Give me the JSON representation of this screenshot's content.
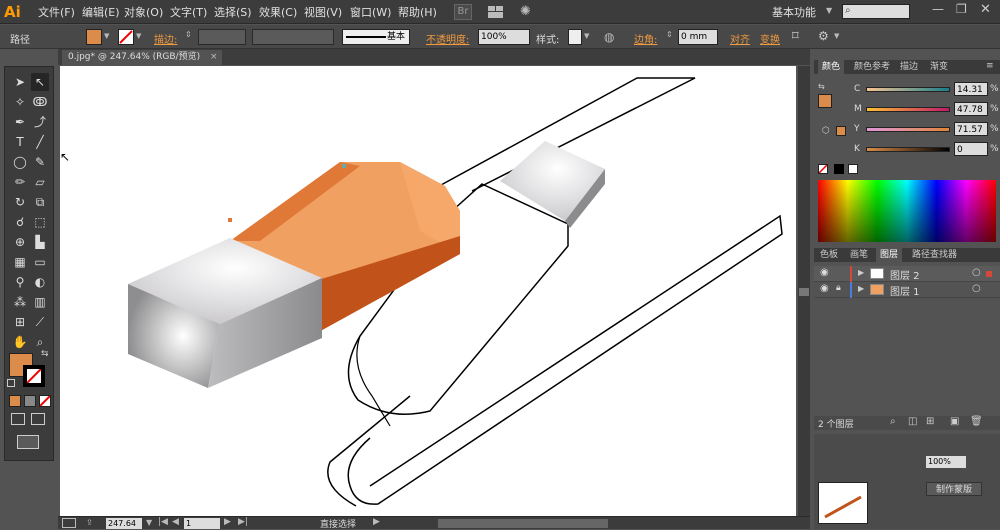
{
  "menubar": {
    "logo": "Ai",
    "items": [
      "文件(F)",
      "编辑(E)",
      "对象(O)",
      "文字(T)",
      "选择(S)",
      "效果(C)",
      "视图(V)",
      "窗口(W)",
      "帮助(H)"
    ],
    "br_label": "Br",
    "workspace": "基本功能"
  },
  "control": {
    "selection_label": "路径",
    "stroke_label": "描边:",
    "stroke_style": "基本",
    "opacity_label": "不透明度:",
    "opacity_value": "100%",
    "style_label": "样式:",
    "corner_label": "边角:",
    "corner_value": "0 mm",
    "align_label": "对齐",
    "transform_label": "变换"
  },
  "document": {
    "tab_title": "0.jpg* @ 247.64% (RGB/预览)",
    "close": "×"
  },
  "status": {
    "zoom": "247.64",
    "page": "1",
    "tool": "直接选择"
  },
  "color_panel": {
    "tabs": [
      "颜色",
      "颜色参考",
      "描边",
      "渐变"
    ],
    "channels": [
      {
        "label": "C",
        "value": "14.31"
      },
      {
        "label": "M",
        "value": "47.78"
      },
      {
        "label": "Y",
        "value": "71.57"
      },
      {
        "label": "K",
        "value": "0"
      }
    ]
  },
  "layers_panel": {
    "tabs": [
      "色板",
      "画笔",
      "图层",
      "路径查找器"
    ],
    "layers": [
      {
        "name": "图层 2",
        "color": "#d4483a"
      },
      {
        "name": "图层 1",
        "color": "#4a7de0"
      }
    ],
    "footer": "2 个图层"
  },
  "bottom_panel": {
    "opacity_value": "100%",
    "make_mask": "制作蒙版"
  },
  "colors": {
    "fill": "#db8c4a",
    "orange": "#f0a060",
    "dark_orange": "#c0521a",
    "grey": "#b7b6b8"
  }
}
